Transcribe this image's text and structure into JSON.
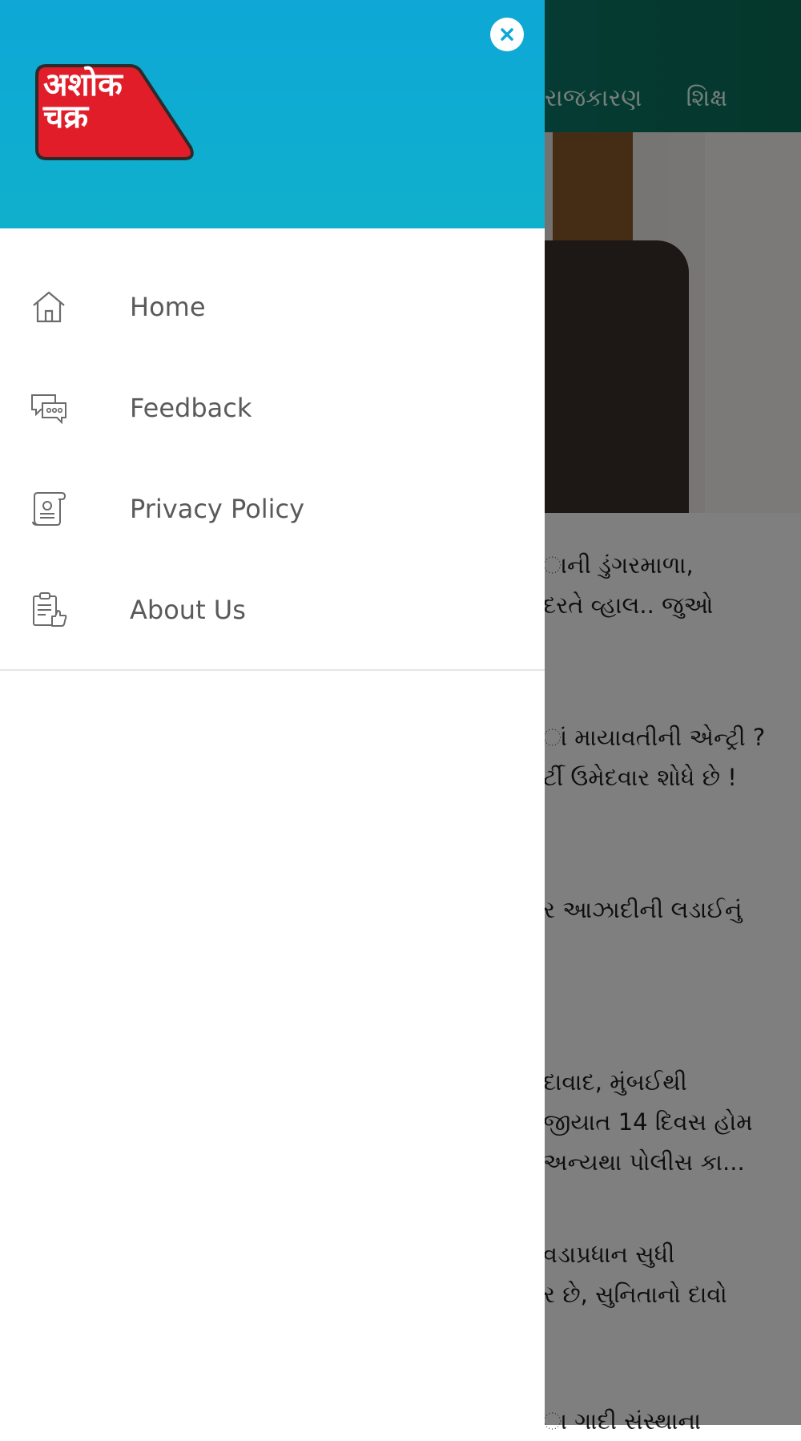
{
  "background": {
    "tabs": [
      "રાજકારણ",
      "શિક્ષ"
    ],
    "news_lines": [
      "ાની ડુંગરમાળા,",
      "દરતે વ્હાલ.. જુઓ",
      "ાં માયાવતીની એન્ટ્રી ?",
      "ર્ટી ઉમેદવાર શોધે છે !",
      "ર આઝાદીની લડાઈનું",
      "દાવાદ, મુંબઈથી",
      "જીયાત 14 દિવસ હોમ",
      " અન્યથા પોલીસ કા...",
      "વડાપ્રધાન સુધી",
      "ર છે, સુનિતાનો દાવો",
      "ા ગાદી સંસ્થાના"
    ]
  },
  "drawer": {
    "logo_text_line1": "अशोक",
    "logo_text_line2": "चक्र",
    "close_icon": "close-icon",
    "menu": [
      {
        "label": "Home",
        "icon": "home-icon"
      },
      {
        "label": "Feedback",
        "icon": "feedback-icon"
      },
      {
        "label": "Privacy Policy",
        "icon": "privacy-policy-icon"
      },
      {
        "label": "About Us",
        "icon": "about-us-icon"
      }
    ]
  },
  "colors": {
    "drawer_header": "#0ea7d6",
    "background_topbar": "#0e8f86",
    "logo_red": "#e21d2a"
  }
}
